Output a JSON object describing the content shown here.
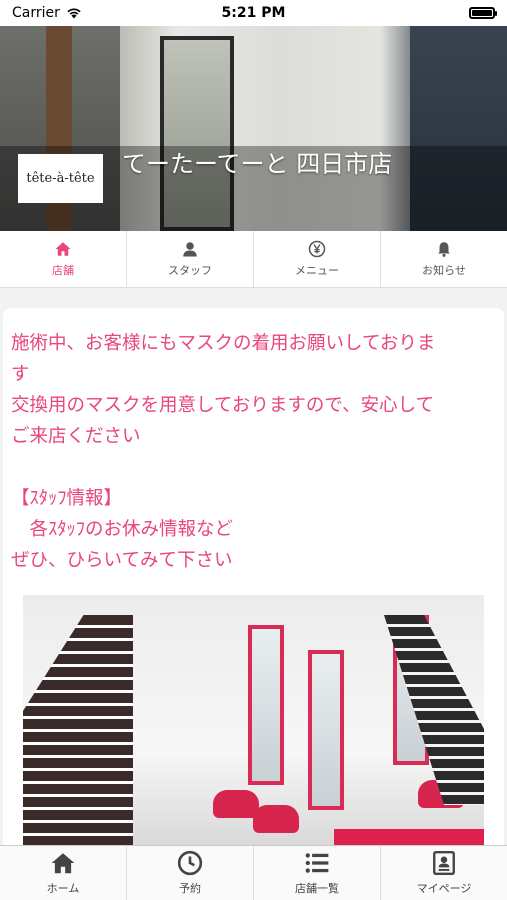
{
  "status_bar": {
    "carrier": "Carrier",
    "time": "5:21 PM"
  },
  "hero": {
    "logo_text": "tête-à-tête",
    "shop_name": "てーたーてーと 四日市店"
  },
  "top_tabs": [
    {
      "label": "店舗",
      "icon": "home-icon",
      "active": true
    },
    {
      "label": "スタッフ",
      "icon": "person-icon",
      "active": false
    },
    {
      "label": "メニュー",
      "icon": "yen-icon",
      "active": false
    },
    {
      "label": "お知らせ",
      "icon": "bell-icon",
      "active": false
    }
  ],
  "notice": {
    "line1": "施術中、お客様にもマスクの着用お願いしておりま",
    "line2": "す",
    "line3": "交換用のマスクを用意しておりますので、安心して",
    "line4": "ご来店ください",
    "line5": "【ｽﾀｯﾌ情報】",
    "line6": "　各ｽﾀｯﾌのお休み情報など",
    "line7": "ぜひ、ひらいてみて下さい"
  },
  "bottom_nav": [
    {
      "label": "ホーム",
      "icon": "home-icon"
    },
    {
      "label": "予約",
      "icon": "clock-icon"
    },
    {
      "label": "店舗一覧",
      "icon": "list-icon"
    },
    {
      "label": "マイページ",
      "icon": "id-card-icon"
    }
  ],
  "colors": {
    "accent": "#e8467c",
    "text_gray": "#555555"
  }
}
